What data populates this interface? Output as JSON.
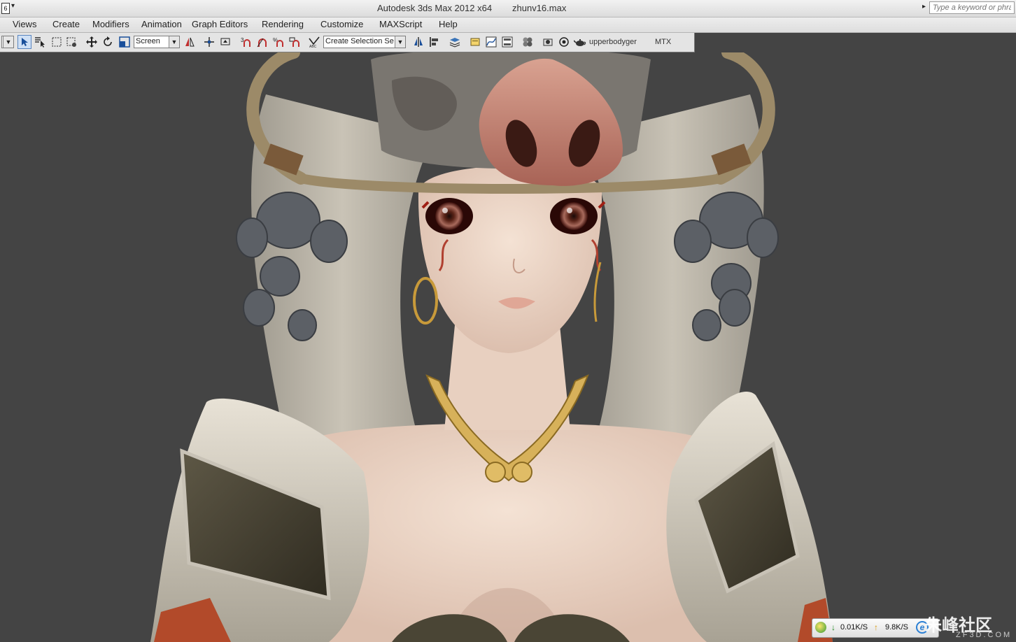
{
  "titlebar": {
    "app_title": "Autodesk 3ds Max  2012 x64",
    "file_title": "zhunv16.max",
    "search_placeholder": "Type a keyword or phrase",
    "app_icon_glyph": "6"
  },
  "menu": {
    "items": [
      "Views",
      "Create",
      "Modifiers",
      "Animation",
      "Graph Editors",
      "Rendering",
      "Customize",
      "MAXScript",
      "Help"
    ]
  },
  "toolbar": {
    "reference_coord": "Screen",
    "selection_set": "Create Selection Se",
    "named_object": "upperbodyger",
    "mtx_label": "MTX"
  },
  "status": {
    "download_speed": "0.01K/S",
    "upload_speed": "9.8K/S",
    "ie_glyph": "e",
    "watermark": "朱峰社区",
    "watermark_sub": "ZF3D.COM"
  },
  "colors": {
    "viewport_bg": "#444444",
    "skin": "#eed8c8",
    "hair": "#bdb7aa",
    "horn": "#9c8a68",
    "gold": "#d7b15a",
    "boar_snout": "#c98a78",
    "armor": "#4a4535"
  },
  "icons": [
    "select-icon",
    "select-by-name-icon",
    "rect-region-icon",
    "window-crossing-icon",
    "move-icon",
    "rotate-icon",
    "scale-icon",
    "mirror-icon",
    "align-icon",
    "snap-icon",
    "angle-snap-icon",
    "percent-snap-icon",
    "spinner-snap-icon",
    "edit-named-selection-icon",
    "layer-icon",
    "curve-editor-icon",
    "schematic-icon",
    "material-editor-icon",
    "render-setup-icon",
    "render-icon",
    "teapot-icon"
  ]
}
